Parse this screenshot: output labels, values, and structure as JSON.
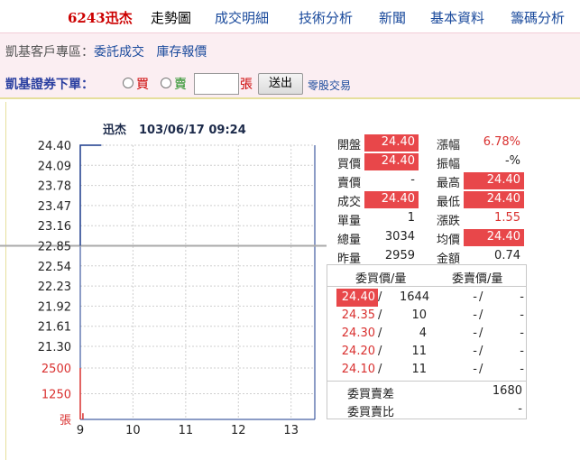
{
  "nav": {
    "stock": "6243迅杰",
    "items": [
      "走勢圖",
      "成交明細",
      "技術分析",
      "新聞",
      "基本資料",
      "籌碼分析"
    ]
  },
  "zone": {
    "label": "凱基客戶專區：",
    "links": [
      "委託成交",
      "庫存報價"
    ]
  },
  "order": {
    "title": "凱基證券下單：",
    "buy": "買",
    "sell": "賣",
    "quantity": "",
    "unit": "張",
    "submit": "送出",
    "odd_lot": "零股交易"
  },
  "chart_title": {
    "name": "迅杰",
    "datetime": "103/06/17 09:24"
  },
  "chart_data": {
    "type": "line",
    "title": "迅杰 103/06/17 09:24",
    "x_ticks": [
      "9",
      "10",
      "11",
      "12",
      "13"
    ],
    "price_ticks": [
      "24.40",
      "24.09",
      "23.78",
      "23.47",
      "23.16",
      "22.85",
      "22.54",
      "22.23",
      "21.92",
      "21.61",
      "21.30"
    ],
    "ylim": [
      21.3,
      24.4
    ],
    "reference_price": 22.85,
    "series": [
      {
        "values": [
          {
            "t": 9.0,
            "price": 22.85
          },
          {
            "t": 9.0,
            "price": 24.4
          },
          {
            "t": 9.4,
            "price": 24.4
          }
        ]
      }
    ],
    "volume_ticks": [
      "2500",
      "1250",
      "張"
    ],
    "volume_max": 2500,
    "volume": [
      {
        "t": 9.0,
        "v": 2500
      },
      {
        "t": 9.05,
        "v": 300
      }
    ],
    "colors": {
      "price_line": "#1a3a8c",
      "volume": "#d9302f",
      "reference": "#aaaaaa",
      "grid": "#cfcfcf"
    }
  },
  "quote": {
    "rows": [
      {
        "l1": "開盤",
        "v1": "24.40",
        "h1": true,
        "c1": "blk",
        "l2": "漲幅",
        "v2": "6.78%",
        "h2": false,
        "c2": "red"
      },
      {
        "l1": "買價",
        "v1": "24.40",
        "h1": true,
        "c1": "blk",
        "l2": "振幅",
        "v2": "-%",
        "h2": false,
        "c2": "blk"
      },
      {
        "l1": "賣價",
        "v1": "-",
        "h1": false,
        "c1": "blk",
        "l2": "最高",
        "v2": "24.40",
        "h2": true,
        "c2": "blk"
      },
      {
        "l1": "成交",
        "v1": "24.40",
        "h1": true,
        "c1": "blk",
        "l2": "最低",
        "v2": "24.40",
        "h2": true,
        "c2": "blk"
      },
      {
        "l1": "單量",
        "v1": "1",
        "h1": false,
        "c1": "blk",
        "l2": "漲跌",
        "v2": "1.55",
        "h2": false,
        "c2": "red"
      },
      {
        "l1": "總量",
        "v1": "3034",
        "h1": false,
        "c1": "blk",
        "l2": "均價",
        "v2": "24.40",
        "h2": true,
        "c2": "blk"
      },
      {
        "l1": "昨量",
        "v1": "2959",
        "h1": false,
        "c1": "blk",
        "l2": "金額",
        "v2": "0.74",
        "h2": false,
        "c2": "blk"
      }
    ]
  },
  "book": {
    "bid_header": "委買價/量",
    "ask_header": "委賣價/量",
    "slash": "/",
    "rows": [
      {
        "bid": "24.40",
        "bid_vol": "1644",
        "ask": "-",
        "ask_vol": "-",
        "hl": true
      },
      {
        "bid": "24.35",
        "bid_vol": "10",
        "ask": "-",
        "ask_vol": "-",
        "hl": false
      },
      {
        "bid": "24.30",
        "bid_vol": "4",
        "ask": "-",
        "ask_vol": "-",
        "hl": false
      },
      {
        "bid": "24.20",
        "bid_vol": "11",
        "ask": "-",
        "ask_vol": "-",
        "hl": false
      },
      {
        "bid": "24.10",
        "bid_vol": "11",
        "ask": "-",
        "ask_vol": "-",
        "hl": false
      }
    ],
    "diff_label": "委買賣差",
    "diff_value": "1680",
    "ratio_label": "委買賣比",
    "ratio_value": "-"
  }
}
